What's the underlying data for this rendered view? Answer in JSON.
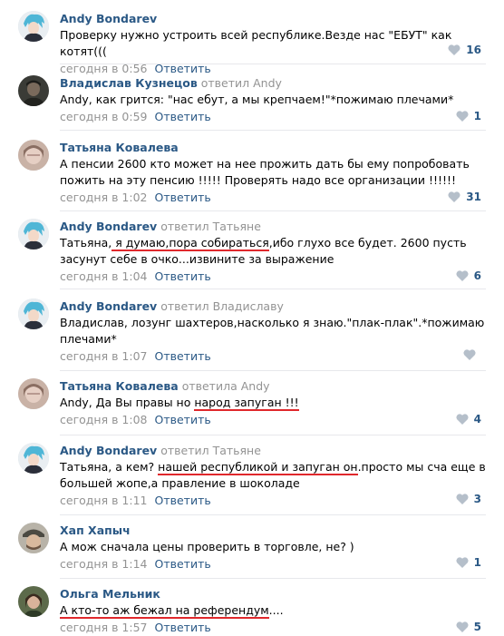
{
  "comments": [
    {
      "author": "Andy Bondarev",
      "replied": "",
      "reply_to": "",
      "text_plain": "Проверку нужно устроить всей республике.Везде нас \"ЕБУТ\" как котят(((",
      "date": "сегодня в 0:56",
      "reply_label": "Ответить",
      "likes": "16",
      "avatar": "anime-blue-hair"
    },
    {
      "author": "Владислав Кузнецов",
      "replied": "ответил",
      "reply_to": "Andy",
      "text_plain": "Andy, как грится: \"нас ебут, а мы крепчаем!\"*пожимаю плечами*",
      "date": "сегодня в 0:59",
      "reply_label": "Ответить",
      "likes": "1",
      "avatar": "dark-photo"
    },
    {
      "author": "Татьяна Ковалева",
      "replied": "",
      "reply_to": "",
      "text_plain": "А пенсии 2600 кто может на нее прожить дать бы ему попробовать пожить на эту пенсию !!!!! Проверять надо все организации !!!!!!",
      "date": "сегодня в 1:02",
      "reply_label": "Ответить",
      "likes": "31",
      "avatar": "woman-photo"
    },
    {
      "author": "Andy Bondarev",
      "replied": "ответил",
      "reply_to": "Татьяне",
      "text_pre": "Татьяна,",
      "text_ul": " я думаю,пора собираться",
      "text_post": ",ибо глухо все будет. 2600 пусть засунут себе в очко...извините за выражение",
      "date": "сегодня в 1:04",
      "reply_label": "Ответить",
      "likes": "6",
      "avatar": "anime-blue-hair"
    },
    {
      "author": "Andy Bondarev",
      "replied": "ответил",
      "reply_to": "Владиславу",
      "text_plain": "Владислав, лозунг шахтеров,насколько я знаю.\"плак-плак\".*пожимаю плечами*",
      "date": "сегодня в 1:07",
      "reply_label": "Ответить",
      "likes": "",
      "avatar": "anime-blue-hair"
    },
    {
      "author": "Татьяна Ковалева",
      "replied": "ответила",
      "reply_to": "Andy",
      "text_pre": "Andy, Да Вы правы но ",
      "text_ul": "народ запуган !!!",
      "text_post": "",
      "date": "сегодня в 1:08",
      "reply_label": "Ответить",
      "likes": "4",
      "avatar": "woman-photo"
    },
    {
      "author": "Andy Bondarev",
      "replied": "ответил",
      "reply_to": "Татьяне",
      "text_pre": "Татьяна, а кем? ",
      "text_ul": "нашей республикой и запуган он",
      "text_post": ".просто мы сча еще в большей жопе,а правление в шоколаде",
      "date": "сегодня в 1:11",
      "reply_label": "Ответить",
      "likes": "3",
      "avatar": "anime-blue-hair"
    },
    {
      "author": "Хап Хапыч",
      "replied": "",
      "reply_to": "",
      "text_plain": "А мож сначала цены проверить в торговле, не? )",
      "date": "сегодня в 1:14",
      "reply_label": "Ответить",
      "likes": "1",
      "avatar": "man-cap-photo"
    },
    {
      "author": "Ольга Мельник",
      "replied": "",
      "reply_to": "",
      "text_pre": "",
      "text_ul": "А кто-то аж бежал на референдум",
      "text_post": "....",
      "date": "сегодня в 1:57",
      "reply_label": "Ответить",
      "likes": "5",
      "avatar": "woman-dark-photo"
    }
  ]
}
